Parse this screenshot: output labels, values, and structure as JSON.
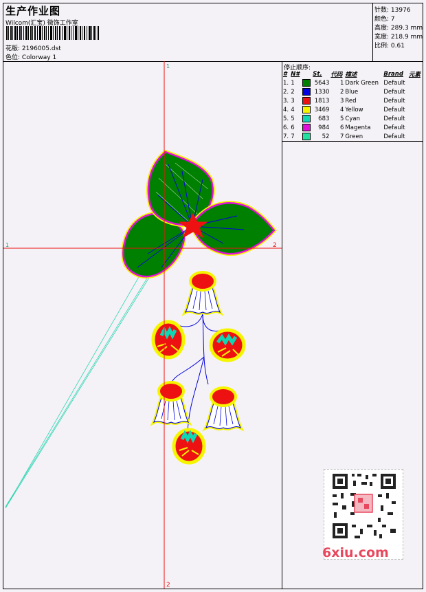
{
  "header": {
    "title": "生产作业图",
    "company": "Wilcom(汇宝) 微饰工作室",
    "design_label": "花版:",
    "design_value": "2196005.dst",
    "colorway_label": "色位:",
    "colorway_value": "Colorway 1"
  },
  "stats": {
    "stitches": {
      "label": "针数:",
      "value": "13976"
    },
    "colors": {
      "label": "颜色:",
      "value": "7"
    },
    "height": {
      "label": "高度:",
      "value": "289.3 mm"
    },
    "width": {
      "label": "宽度:",
      "value": "218.9 mm"
    },
    "scale": {
      "label": "比例:",
      "value": "0.61"
    }
  },
  "canvas": {
    "guide_top": "1",
    "guide_bottom": "2",
    "guide_left": "1",
    "guide_right": "2"
  },
  "stop_sequence": {
    "title": "停止顺序:",
    "columns": [
      "#",
      "N#",
      "St.",
      "代码",
      "描述",
      "Brand",
      "元素"
    ],
    "rows": [
      {
        "idx": "1.",
        "n": "1",
        "color": "#008000",
        "st": "5643",
        "code": "1",
        "desc": "Dark Green",
        "brand": "Default"
      },
      {
        "idx": "2.",
        "n": "2",
        "color": "#0000e0",
        "st": "1330",
        "code": "2",
        "desc": "Blue",
        "brand": "Default"
      },
      {
        "idx": "3.",
        "n": "3",
        "color": "#ee1111",
        "st": "1813",
        "code": "3",
        "desc": "Red",
        "brand": "Default"
      },
      {
        "idx": "4.",
        "n": "4",
        "color": "#f5f500",
        "st": "3469",
        "code": "4",
        "desc": "Yellow",
        "brand": "Default"
      },
      {
        "idx": "5.",
        "n": "5",
        "color": "#11d6b4",
        "st": "683",
        "code": "5",
        "desc": "Cyan",
        "brand": "Default"
      },
      {
        "idx": "6.",
        "n": "6",
        "color": "#e010d8",
        "st": "984",
        "code": "6",
        "desc": "Magenta",
        "brand": "Default"
      },
      {
        "idx": "7.",
        "n": "7",
        "color": "#22e0a0",
        "st": "52",
        "code": "7",
        "desc": "Green",
        "brand": "Default"
      }
    ]
  },
  "watermark": {
    "text": "6xiu.com",
    "qr_icon": "qr-code-icon"
  }
}
